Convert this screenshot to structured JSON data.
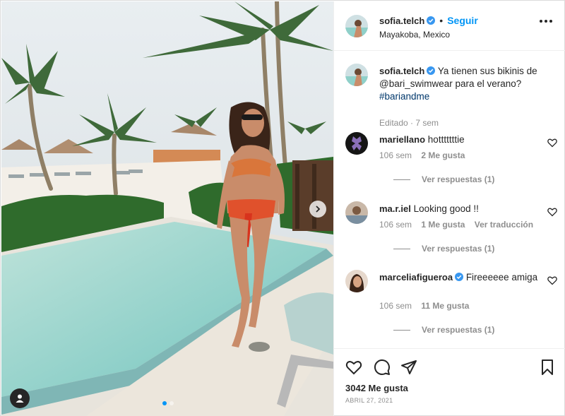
{
  "post": {
    "author": "sofia.telch",
    "follow_label": "Seguir",
    "separator": "•",
    "location": "Mayakoba, Mexico",
    "caption_author": "sofia.telch",
    "caption_text": "Ya tienen sus bikinis de @bari_swimwear para el verano?",
    "caption_hashtag": "#bariandme",
    "caption_meta": "Editado · 7 sem",
    "likes": "3042 Me gusta",
    "date": "ABRIL 27, 2021"
  },
  "comments": [
    {
      "user": "mariellano",
      "text": "hotttttttie",
      "age": "106 sem",
      "likes": "2 Me gusta",
      "replies": "Ver respuestas (1)",
      "verified": false
    },
    {
      "user": "ma.r.iel",
      "text": "Looking good !!",
      "age": "106 sem",
      "likes": "1 Me gusta",
      "translate": "Ver traducción",
      "replies": "Ver respuestas (1)",
      "verified": false
    },
    {
      "user": "marceliafigueroa",
      "text": "Fireeeeee amiga",
      "age": "106 sem",
      "likes": "11 Me gusta",
      "replies": "Ver respuestas (1)",
      "verified": true
    }
  ],
  "icons": {
    "verified": "verified-badge-icon",
    "more": "more-options-icon",
    "next": "chevron-right-icon",
    "tag": "user-tag-icon",
    "like": "heart-icon",
    "comment": "comment-icon",
    "share": "send-icon",
    "save": "bookmark-icon"
  },
  "carousel": {
    "count": 2,
    "active": 1
  },
  "colors": {
    "accent": "#0095f6",
    "text": "#262626",
    "muted": "#8e8e8e",
    "verified": "#3897f0"
  }
}
